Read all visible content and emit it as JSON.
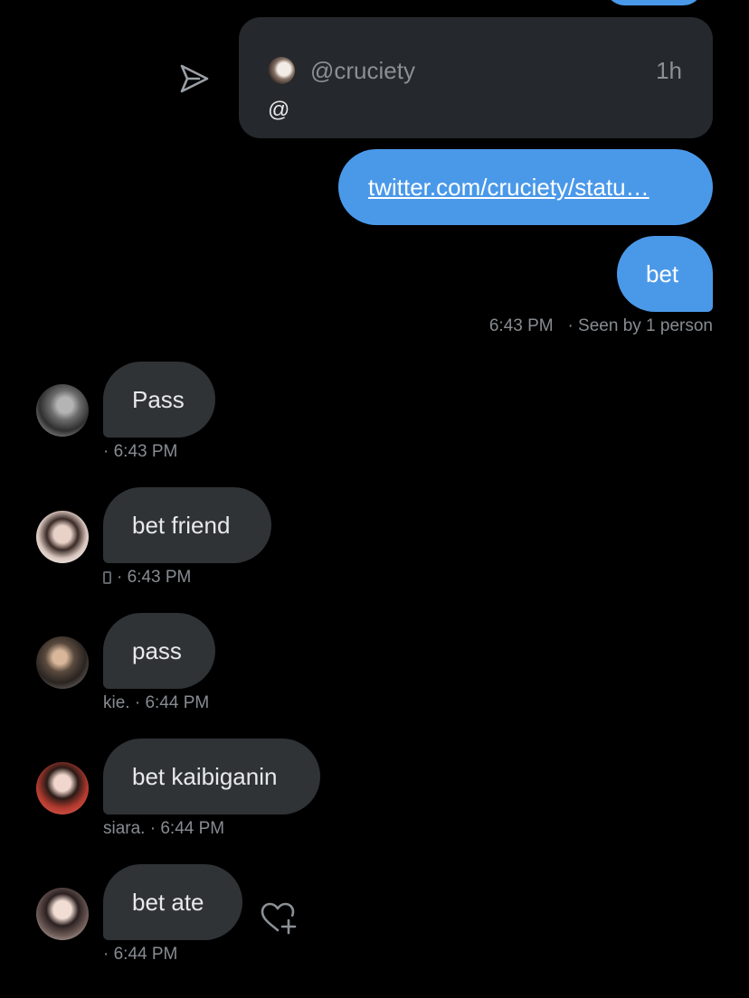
{
  "colors": {
    "background": "#000000",
    "outgoing_bubble": "#4a99e9",
    "incoming_bubble": "#2f3336",
    "card": "#25282c",
    "meta_text": "#878c91"
  },
  "icons": {
    "share": "send-icon",
    "reaction": "heart-add-icon",
    "device": "phone-icon"
  },
  "quoted_tweet": {
    "handle": "@cruciety",
    "time": "1h",
    "text": "@"
  },
  "outgoing": {
    "link": "twitter.com/cruciety/statu…",
    "message": "bet",
    "time": "6:43 PM",
    "seen": "· Seen by 1 person"
  },
  "incoming": [
    {
      "text": "Pass",
      "sender": "",
      "time": "· 6:43 PM"
    },
    {
      "text": "bet friend",
      "sender": "",
      "time": "· 6:43 PM"
    },
    {
      "text": "pass",
      "sender": "kie.",
      "time": "· 6:44 PM"
    },
    {
      "text": "bet kaibiganin",
      "sender": "siara.",
      "time": "· 6:44 PM"
    },
    {
      "text": "bet ate",
      "sender": "",
      "time": "· 6:44 PM"
    }
  ]
}
